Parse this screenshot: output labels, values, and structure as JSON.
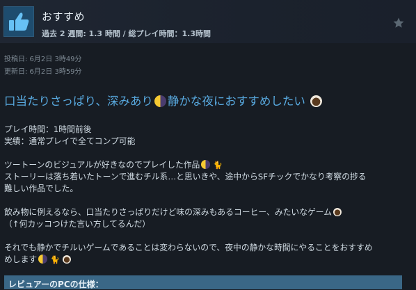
{
  "header": {
    "recommendation": "おすすめ",
    "hours": "過去 2 週間: 1.3 時間 / 総プレイ時間：1.3時間",
    "thumb_icon": "thumbs-up-icon",
    "star_icon": "star-icon"
  },
  "dates": {
    "posted": "投稿日: 6月2日 3時49分",
    "updated": "更新日: 6月2日 3時59分"
  },
  "review": {
    "headline_a": "口当たりさっぱり、深みあり",
    "headline_b": "静かな夜におすすめしたい",
    "p1_line1": "プレイ時間：1時間前後",
    "p1_line2": "実績：通常プレイで全てコンプ可能",
    "p2_line1": "ツートーンのビジュアルが好きなのでプレイした作品",
    "p2_line2": "ストーリーは落ち着いたトーンで進むチル系…と思いきや、途中からSFチックでかなり考察の捗る",
    "p2_line3": "難しい作品でした。",
    "p3_line1": "飲み物に例えるなら、口当たりさっぱりだけど味の深みもあるコーヒー、みたいなゲーム",
    "p3_line2": "（↑何カッコつけた言い方してるんだ）",
    "p4_line1": "それでも静かでチルいゲームであることは変わらないので、夜中の静かな時間にやることをおすすめ",
    "p4_line2": "めします"
  },
  "spec_header": "レビュアーのPCの仕様：",
  "colors": {
    "background": "#171c23",
    "headline": "#58a9df",
    "thumb_bg": "#1e4c6e"
  }
}
